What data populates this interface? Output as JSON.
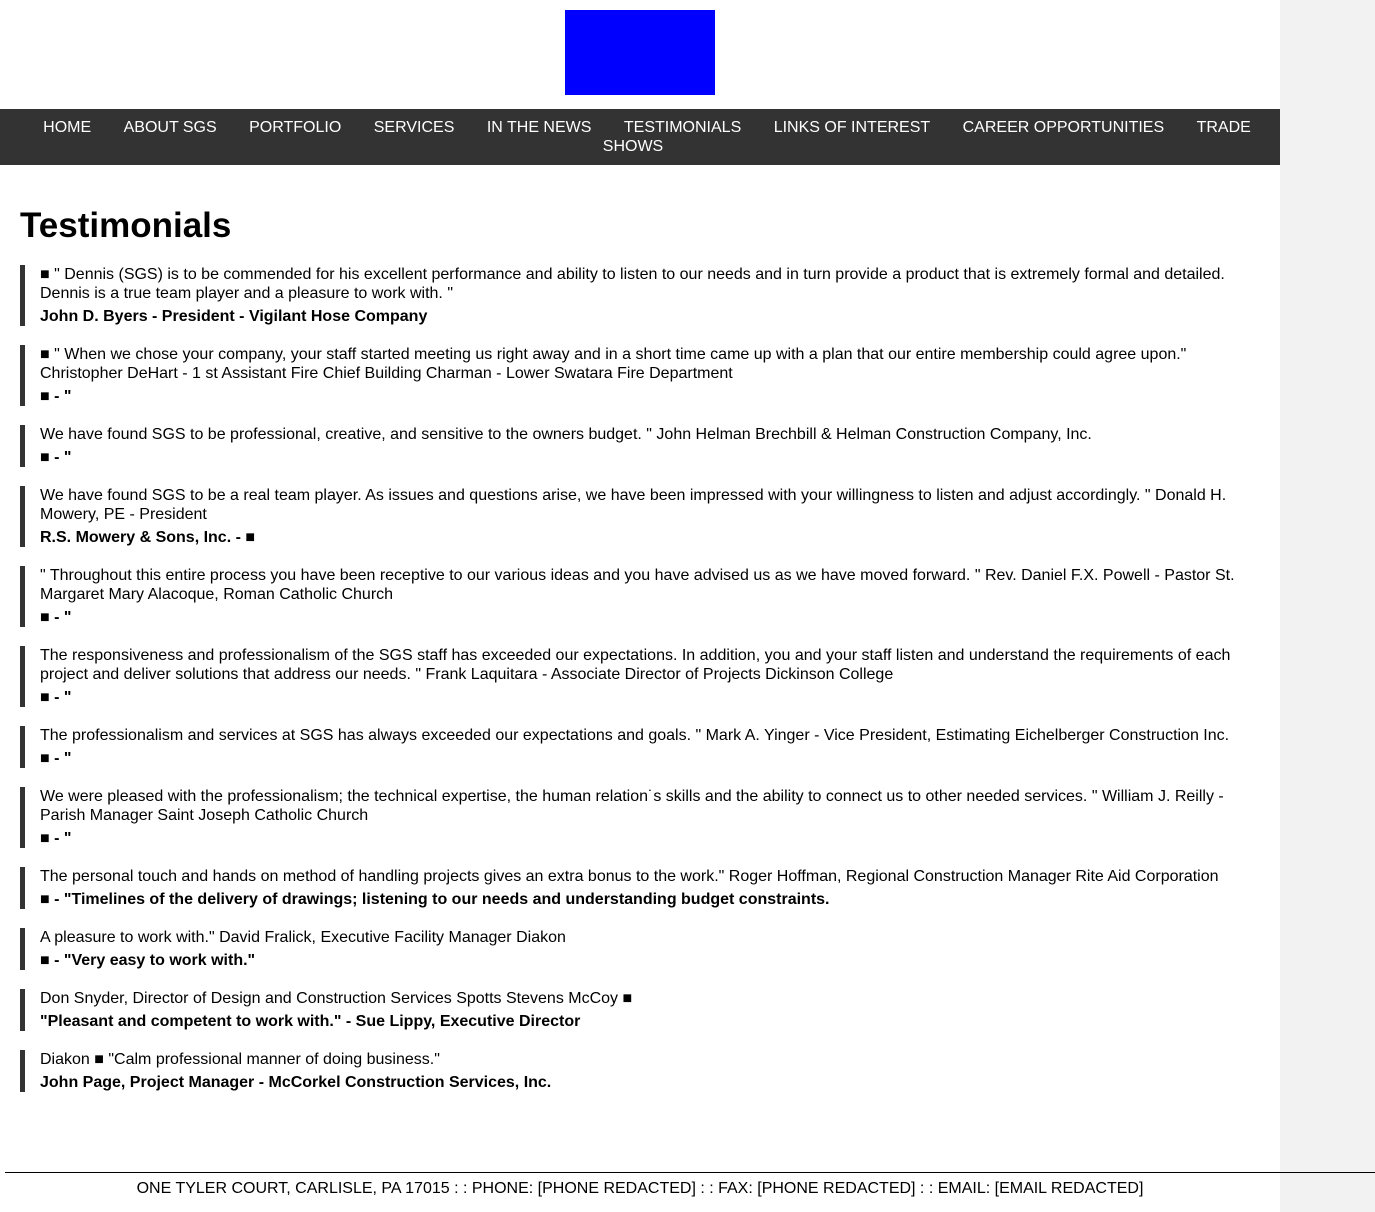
{
  "brand": {
    "logo_color": "#0000ff"
  },
  "nav": {
    "items": [
      "HOME",
      "ABOUT SGS",
      "PORTFOLIO",
      "SERVICES",
      "IN THE NEWS",
      "TESTIMONIALS",
      "LINKS OF INTEREST",
      "CAREER OPPORTUNITIES",
      "TRADE SHOWS"
    ]
  },
  "page": {
    "title": "Testimonials"
  },
  "testimonials": [
    {
      "text": "■ \" Dennis (SGS) is to be commended for his excellent performance and ability to listen to our needs and in turn provide a product that is extremely formal and detailed. Dennis is a true team player and a pleasure to work with. \"",
      "author": "John D. Byers - President - Vigilant Hose Company"
    },
    {
      "text": "■ \" When we chose your company, your staff started meeting us right away and in a short time came up with a plan that our entire membership could agree upon.\" Christopher DeHart - 1 st Assistant Fire Chief Building Charman - Lower Swatara Fire Department",
      "author": "■ - \""
    },
    {
      "text": "We have found SGS to be professional, creative, and sensitive to the owners budget. \" John Helman Brechbill & Helman Construction Company, Inc.",
      "author": "■ - \""
    },
    {
      "text": "We have found SGS to be a real team player. As issues and questions arise, we have been impressed with your willingness to listen and adjust accordingly. \" Donald H. Mowery, PE - President",
      "author": "R.S. Mowery & Sons, Inc. - ■"
    },
    {
      "text": "\" Throughout this entire process you have been receptive to our various ideas and you have advised us as we have moved forward. \" Rev. Daniel F.X. Powell - Pastor St. Margaret Mary Alacoque, Roman Catholic Church",
      "author": "■ - \""
    },
    {
      "text": "The responsiveness and professionalism of the SGS staff has exceeded our expectations. In addition, you and your staff listen and understand the requirements of each project and deliver solutions that address our needs. \" Frank Laquitara - Associate Director of Projects Dickinson College",
      "author": "■ - \""
    },
    {
      "text": "The professionalism and services at SGS has always exceeded our expectations and goals. \" Mark A. Yinger - Vice President, Estimating Eichelberger Construction Inc.",
      "author": "■ - \""
    },
    {
      "text": "We were pleased with the professionalism; the technical expertise, the human relation˙s skills and the ability to connect us to other needed services. \" William J. Reilly - Parish Manager Saint Joseph Catholic Church",
      "author": "■ - \""
    },
    {
      "text": "The personal touch and hands on method of handling projects gives an extra bonus to the work.\" Roger Hoffman, Regional Construction Manager Rite Aid Corporation",
      "author": "■ - \"Timelines of the delivery of drawings; listening to our needs and understanding budget constraints."
    },
    {
      "text": "A pleasure to work with.\" David Fralick, Executive Facility Manager Diakon",
      "author": "■ - \"Very easy to work with.\""
    },
    {
      "text": "Don Snyder, Director of Design and Construction Services Spotts Stevens McCoy ■",
      "author": "\"Pleasant and competent to work with.\" - Sue Lippy, Executive Director"
    },
    {
      "text": "Diakon ■ \"Calm professional manner of doing business.\"",
      "author": "John Page, Project Manager - McCorkel Construction Services, Inc."
    }
  ],
  "footer": {
    "text": "ONE TYLER COURT, CARLISLE, PA 17015 : : PHONE: [PHONE REDACTED] : : FAX: [PHONE REDACTED] : : EMAIL: [EMAIL REDACTED]"
  }
}
